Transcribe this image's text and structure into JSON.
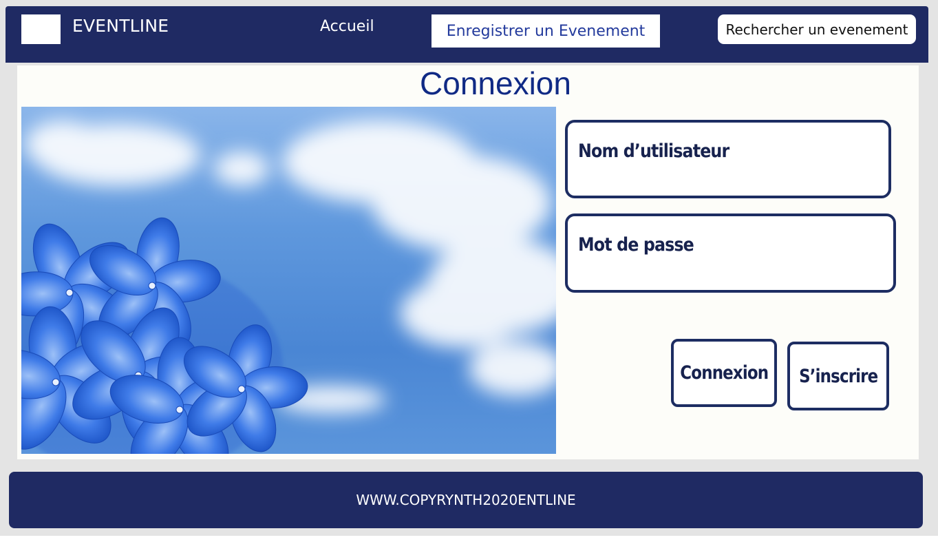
{
  "nav": {
    "brand": "EVENTLINE",
    "home": "Accueil",
    "register_event": "Enregistrer un Evenement",
    "search_event": "Rechercher un evenement"
  },
  "page": {
    "title": "Connexion"
  },
  "form": {
    "username_placeholder": "Nom d’utilisateur",
    "password_placeholder": "Mot de passe",
    "login_button": "Connexion",
    "signup_button": "S’inscrire"
  },
  "footer": {
    "text": "WWW.COPYRYNTH2020ENTLINE"
  },
  "colors": {
    "navy": "#1f2a63",
    "title_blue": "#102a85",
    "link_blue": "#233a9c"
  },
  "icons": {
    "logo": "logo-placeholder",
    "hero": "blue-flowers-sky-image"
  }
}
